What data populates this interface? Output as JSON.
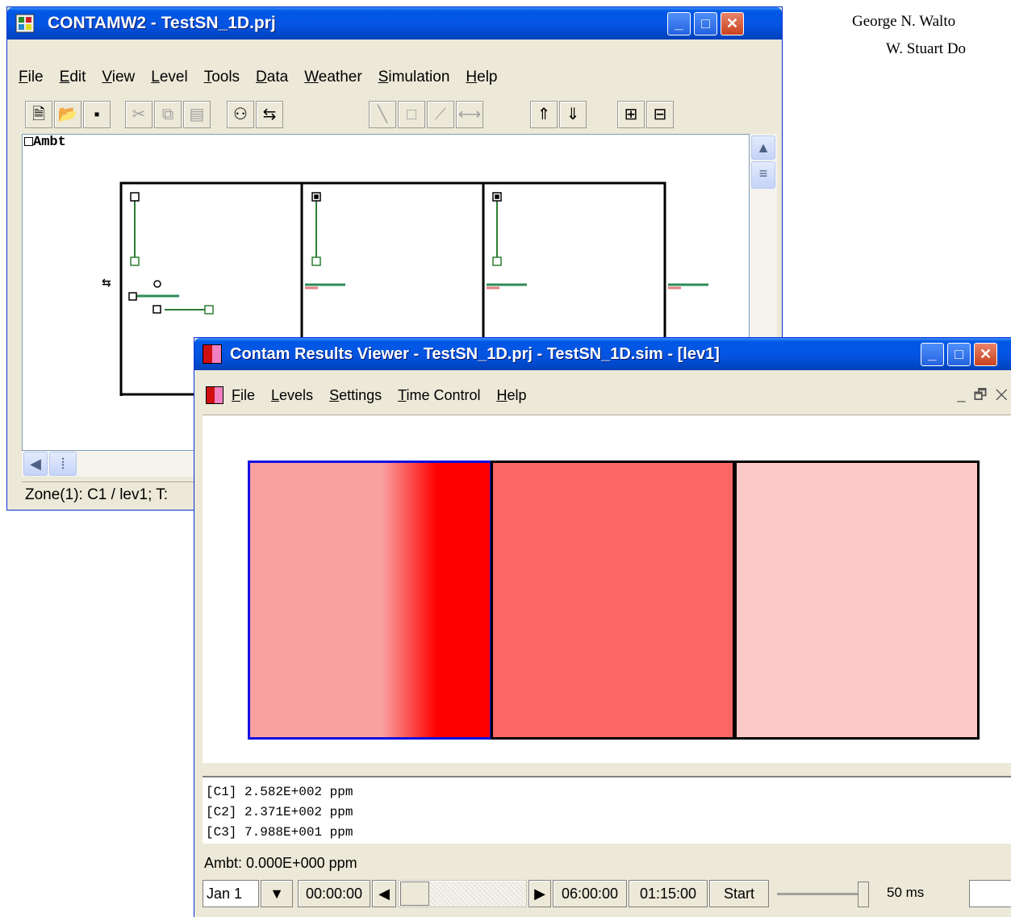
{
  "authors": [
    "George N. Walto",
    "W. Stuart Do"
  ],
  "contam": {
    "title": "CONTAMW2 - TestSN_1D.prj",
    "menu": [
      {
        "label": "File",
        "u": "F",
        "rest": "ile"
      },
      {
        "label": "Edit",
        "u": "E",
        "rest": "dit"
      },
      {
        "label": "View",
        "u": "V",
        "rest": "iew"
      },
      {
        "label": "Level",
        "u": "L",
        "rest": "evel"
      },
      {
        "label": "Tools",
        "u": "T",
        "rest": "ools"
      },
      {
        "label": "Data",
        "u": "D",
        "rest": "ata"
      },
      {
        "label": "Weather",
        "u": "W",
        "rest": "eather"
      },
      {
        "label": "Simulation",
        "u": "S",
        "rest": "imulation"
      },
      {
        "label": "Help",
        "u": "H",
        "rest": "elp"
      }
    ],
    "ambient_label": "Ambt",
    "status": "Zone(1): C1 / lev1; T:"
  },
  "viewer": {
    "title": "Contam Results Viewer - TestSN_1D.prj - TestSN_1D.sim - [lev1]",
    "menu": [
      {
        "label": "File",
        "u": "F",
        "rest": "ile"
      },
      {
        "label": "Levels",
        "u": "L",
        "rest": "evels"
      },
      {
        "label": "Settings",
        "u": "S",
        "rest": "ettings"
      },
      {
        "label": "Time Control",
        "u": "T",
        "rest": "ime Control"
      },
      {
        "label": "Help",
        "u": "H",
        "rest": "elp"
      }
    ],
    "readouts": [
      "[C1] 2.582E+002 ppm",
      "[C2] 2.371E+002 ppm",
      "[C3] 7.988E+001 ppm"
    ],
    "ambient_status": "Ambt: 0.000E+000 ppm",
    "date": "Jan 1",
    "start_time": "00:00:00",
    "end_time": "06:00:00",
    "step_time": "01:15:00",
    "start_button": "Start",
    "delay": "50 ms",
    "colors": {
      "zone1_light": "#f9a0a0",
      "zone1_dark": "#ff0000",
      "zone2": "#fe6666",
      "zone3": "#fcc8c8"
    }
  }
}
